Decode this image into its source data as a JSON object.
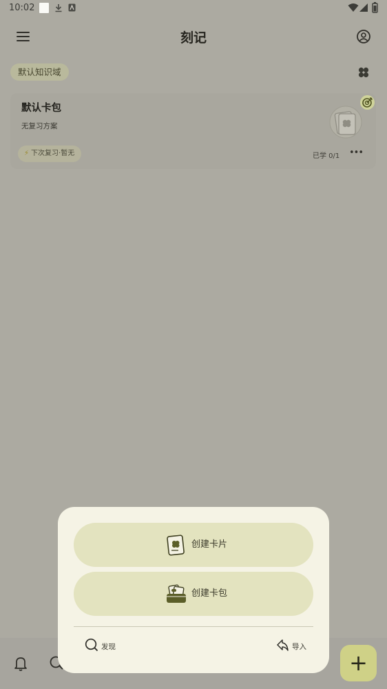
{
  "status_bar": {
    "time": "10:02"
  },
  "app_bar": {
    "title": "刻记"
  },
  "domain_chip": {
    "label": "默认知识域"
  },
  "deck_card": {
    "title": "默认卡包",
    "subtitle": "无复习方案",
    "next_review": "下次复习·暂无",
    "progress": "已学 0/1",
    "more": "•••"
  },
  "popup": {
    "create_card": "创建卡片",
    "create_deck": "创建卡包",
    "discover": "发现",
    "import": "导入"
  },
  "fab": {
    "icon": "+"
  },
  "colors": {
    "accent": "#cfd187",
    "scrim": "#acaaa1",
    "popup_bg": "#f5f3e5",
    "button_bg": "#e3e3bf"
  }
}
